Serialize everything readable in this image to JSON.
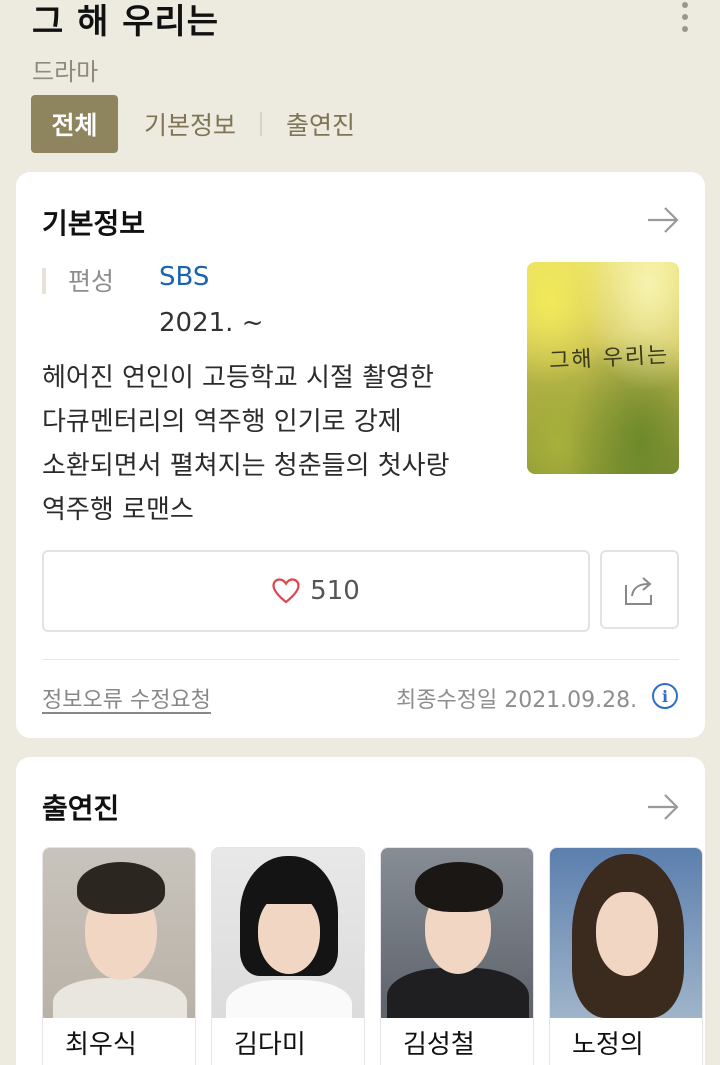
{
  "header": {
    "title": "그 해 우리는",
    "genre": "드라마",
    "tabs": {
      "all": "전체",
      "basic": "기본정보",
      "cast": "출연진"
    }
  },
  "basic_info": {
    "title": "기본정보",
    "label": "편성",
    "network": "SBS",
    "year": "2021. ~",
    "synopsis": "헤어진 연인이 고등학교 시절 촬영한 다큐멘터리의 역주행 인기로 강제 소환되면서 펼쳐지는 청춘들의 첫사랑 역주행 로맨스",
    "poster_text": "그해 우리는",
    "like_count": "510",
    "report_link": "정보오류 수정요청",
    "last_modified": "최종수정일 2021.09.28."
  },
  "cast": {
    "title": "출연진",
    "members": [
      {
        "name": "최우식"
      },
      {
        "name": "김다미"
      },
      {
        "name": "김성철"
      },
      {
        "name": "노정의"
      }
    ]
  },
  "colors": {
    "background": "#edeadf",
    "tab_active": "#8e855f",
    "link_blue": "#1a63b3",
    "heart": "#e0454f"
  },
  "icons": [
    "more-vertical-icon",
    "arrow-right-icon",
    "heart-icon",
    "share-icon",
    "info-icon"
  ]
}
